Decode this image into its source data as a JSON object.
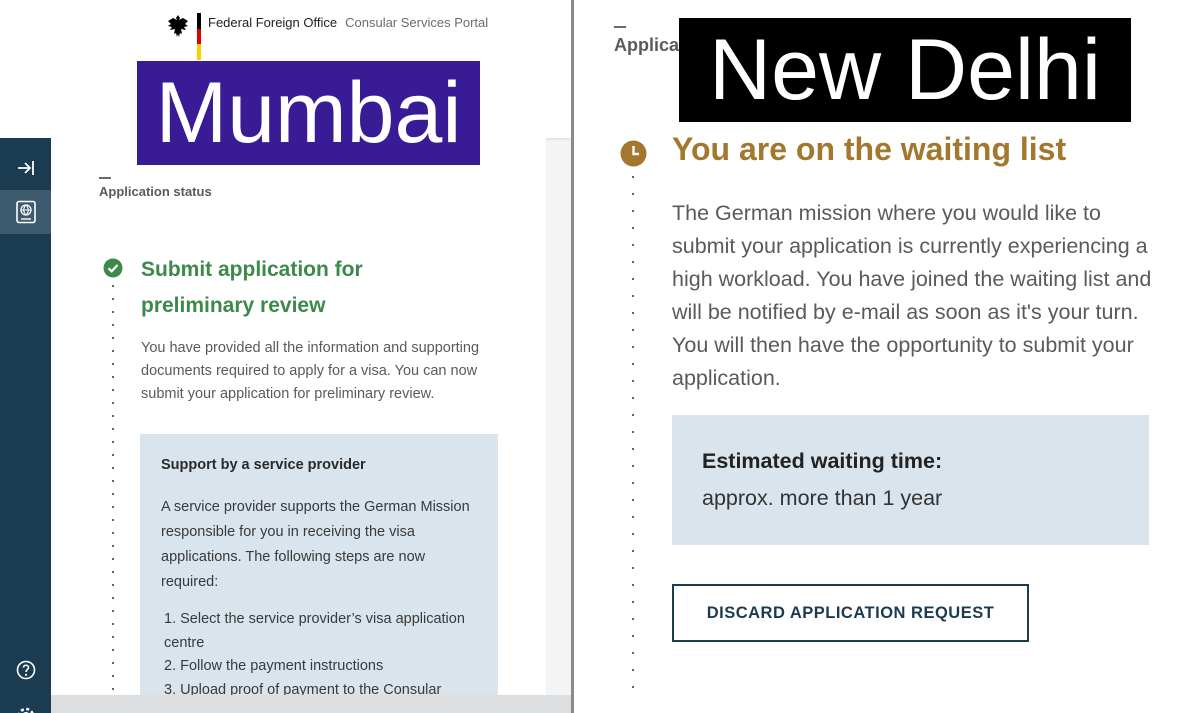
{
  "header": {
    "brand_name": "Federal Foreign Office",
    "portal_name": "Consular Services Portal"
  },
  "overlays": {
    "left_city": "Mumbai",
    "right_city": "New Delhi"
  },
  "left": {
    "section_label": "Application status",
    "status_title": "Submit application for preliminary review",
    "status_text": "You have provided all the information and supporting documents required to apply for a visa. You can now submit your application for preliminary review.",
    "provider_box": {
      "title": "Support by a service provider",
      "text": "A service provider supports the German Mission responsible for you in receiving the visa applications. The following steps are now required:",
      "steps": [
        "1. Select the service provider’s visa application centre",
        "2. Follow the payment instructions",
        "3. Upload proof of payment to the Consular"
      ]
    }
  },
  "right": {
    "section_label": "Applicat",
    "status_title": "You are on the waiting list",
    "status_text": "The German mission where you would like to submit your application is currently experiencing a high workload. You have joined the waiting list and will be notified by e-mail as soon as it's your turn. You will then have the opportunity to submit your application.",
    "waiting_box": {
      "label": "Estimated waiting time:",
      "value": "approx. more than 1 year"
    },
    "discard_button": "DISCARD APPLICATION REQUEST"
  },
  "icons": {
    "sidebar_expand": "arrow-to-right-icon",
    "sidebar_application": "passport-globe-icon",
    "sidebar_help": "question-circle-icon",
    "sidebar_settings": "gear-icon",
    "status_done": "check-circle-icon",
    "status_waiting": "clock-icon"
  },
  "colors": {
    "sidebar_bg": "#1b3b50",
    "sidebar_active": "#3d5a6e",
    "success_green": "#3c8a4a",
    "waiting_gold": "#a1782e",
    "info_box": "#d9e4ec",
    "mumbai_box": "#3a1b96",
    "delhi_box": "#000000",
    "flag_black": "#000000",
    "flag_red": "#dd0000",
    "flag_gold": "#ffce00"
  }
}
